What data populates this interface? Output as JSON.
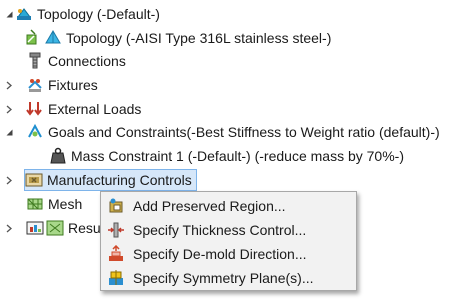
{
  "tree": {
    "root": {
      "label": "Topology (-Default-)",
      "icon": "topology-study-icon"
    },
    "items": [
      {
        "label": "Topology (-AISI Type 316L stainless steel-)",
        "icon": "part-material-icon",
        "expander": ""
      },
      {
        "label": "Connections",
        "icon": "connections-icon",
        "expander": ""
      },
      {
        "label": "Fixtures",
        "icon": "fixtures-icon",
        "expander": "collapsed"
      },
      {
        "label": "External Loads",
        "icon": "external-loads-icon",
        "expander": "collapsed"
      },
      {
        "label": "Goals and Constraints(-Best Stiffness to Weight ratio (default)-)",
        "icon": "goals-constraints-icon",
        "expander": "expanded"
      },
      {
        "label": "Mass Constraint 1 (-Default-)  (-reduce mass by 70%-)",
        "icon": "mass-constraint-icon",
        "expander": ""
      },
      {
        "label": "Manufacturing Controls",
        "icon": "manufacturing-controls-icon",
        "expander": "collapsed"
      },
      {
        "label": "Mesh",
        "icon": "mesh-icon",
        "expander": ""
      },
      {
        "label": "Resu",
        "icon": "results-icon",
        "expander": "collapsed"
      }
    ]
  },
  "context_menu": {
    "items": [
      {
        "label": "Add Preserved Region...",
        "icon": "preserved-region-icon"
      },
      {
        "label": "Specify Thickness Control...",
        "icon": "thickness-control-icon"
      },
      {
        "label": "Specify De-mold Direction...",
        "icon": "demold-direction-icon"
      },
      {
        "label": "Specify Symmetry Plane(s)...",
        "icon": "symmetry-plane-icon"
      }
    ]
  },
  "colors": {
    "selection_bg": "#d6e7f9",
    "selection_border": "#7eb4ea",
    "menu_bg": "#f2f2f2"
  }
}
